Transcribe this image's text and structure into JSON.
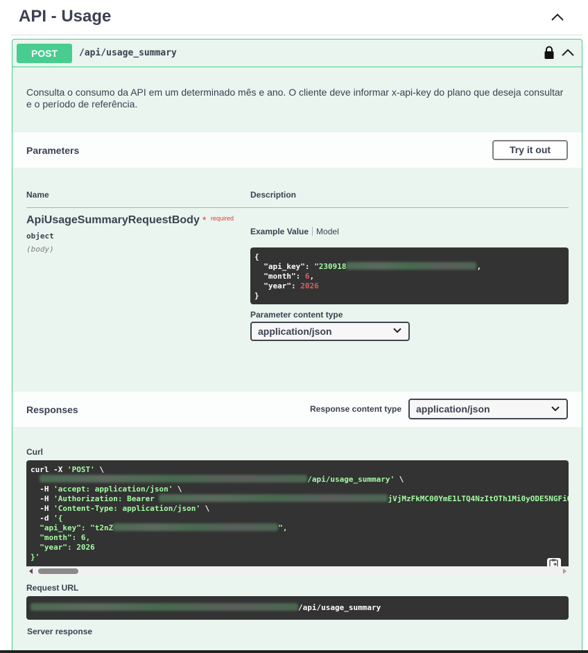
{
  "section": {
    "title": "API - Usage"
  },
  "operation": {
    "method": "POST",
    "path": "/api/usage_summary",
    "description": "Consulta o consumo da API em um determinado mês e ano. O cliente deve informar x-api-key do plano que deseja consultar e o período de referência."
  },
  "parameters": {
    "title": "Parameters",
    "try_button": "Try it out",
    "col_name": "Name",
    "col_description": "Description",
    "param_name": "ApiUsageSummaryRequestBody",
    "required_star": "*",
    "required_label": "required",
    "param_type": "object",
    "param_in": "(body)",
    "tab_example": "Example Value",
    "tab_model": "Model",
    "example": {
      "open": "{",
      "k_api_key": "\"api_key\"",
      "v_api_key": "\"230918",
      "k_month": "\"month\"",
      "v_month": "6",
      "k_year": "\"year\"",
      "v_year": "2026",
      "close": "}"
    },
    "content_type_label": "Parameter content type",
    "content_type_value": "application/json"
  },
  "responses": {
    "title": "Responses",
    "content_type_label": "Response content type",
    "content_type_value": "application/json"
  },
  "curl": {
    "label": "Curl",
    "line1_a": "curl -X ",
    "line1_b": "'POST'",
    "line1_c": " \\",
    "line2_url_end": "/api/usage_summary'",
    "line2_c": " \\",
    "line3_a": "  -H ",
    "line3_b": "'accept: application/json'",
    "line3_c": " \\",
    "line4_a": "  -H ",
    "line4_b": "'Authorization: Bearer ",
    "line4_tail": "jVjMzFkMC00YmE1LTQ4NzItOTh1Mi0yODE5NGFiO",
    "line5_a": "  -H ",
    "line5_b": "'Content-Type: application/json'",
    "line5_c": " \\",
    "line6_a": "  -d ",
    "line6_b": "'{",
    "line7_key": "  \"api_key\": ",
    "line7_val": "\"t2nZ",
    "line7_end": "\",",
    "line8": "  \"month\": 6,",
    "line9": "  \"year\": 2026",
    "line10": "}'"
  },
  "request_url": {
    "label": "Request URL",
    "value_end": "/api/usage_summary"
  },
  "server_response": {
    "label": "Server response"
  },
  "colors": {
    "post_green": "#49cc90",
    "block_bg": "#e9f5ee",
    "code_bg": "#333333",
    "required_red": "#e03c3c"
  }
}
